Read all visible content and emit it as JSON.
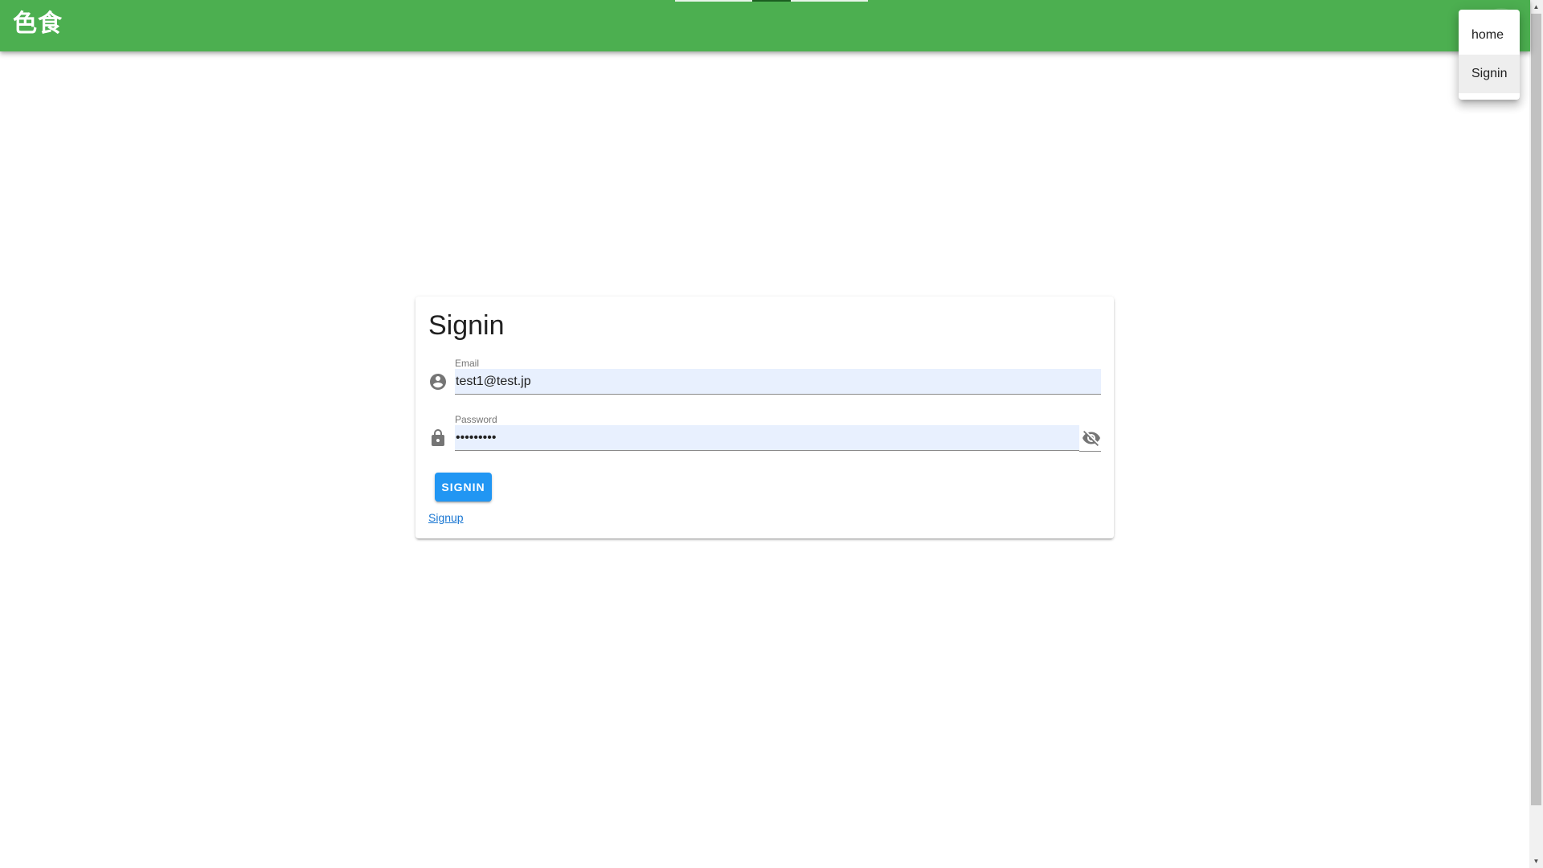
{
  "app": {
    "brand": "色食",
    "bar_color": "#4caf50"
  },
  "menu": {
    "items": [
      {
        "label": "home",
        "active": false
      },
      {
        "label": "Signin",
        "active": true
      }
    ]
  },
  "signin": {
    "title": "Signin",
    "email": {
      "label": "Email",
      "value": "test1@test.jp",
      "icon": "account-circle-icon"
    },
    "password": {
      "label": "Password",
      "value": "•••••••••",
      "icon": "lock-icon",
      "toggle_icon": "eye-off-icon"
    },
    "submit_label": "SIGNIN",
    "signup_link": "Signup"
  },
  "colors": {
    "primary": "#2196f3",
    "autofill": "#e8f0fe",
    "link": "#1976d2"
  }
}
